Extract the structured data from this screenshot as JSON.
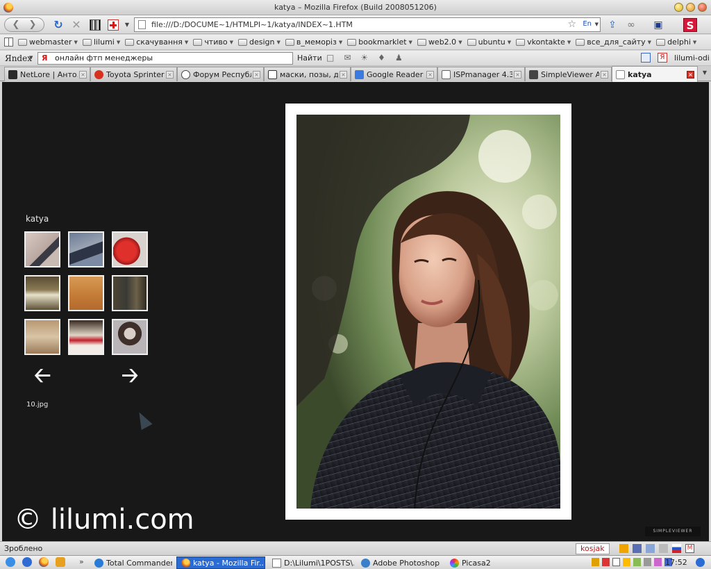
{
  "window": {
    "title": "katya – Mozilla Firefox (Build 2008051206)"
  },
  "navbar": {
    "url": "file:///D:/DOCUME~1/HTMLPI~1/katya/INDEX~1.HTM",
    "lang_indicator": "En"
  },
  "bookmarks": [
    {
      "label": "webmaster"
    },
    {
      "label": "lilumi"
    },
    {
      "label": "скачування"
    },
    {
      "label": "чтиво"
    },
    {
      "label": "design"
    },
    {
      "label": "в_меморіз"
    },
    {
      "label": "bookmarklet"
    },
    {
      "label": "web2.0"
    },
    {
      "label": "ubuntu"
    },
    {
      "label": "vkontakte"
    },
    {
      "label": "все_для_сайту"
    },
    {
      "label": "delphi"
    }
  ],
  "yandex": {
    "logo": "Яndex",
    "search_value": "онлайн фтп менеджеры",
    "find_label": "Найти",
    "user_label": "lilumi-odi"
  },
  "tabs": [
    {
      "label": "NetLore | Анто...",
      "icon": "netlore-icon",
      "active": false
    },
    {
      "label": "Toyota Sprinter ...",
      "icon": "toyota-icon",
      "active": false
    },
    {
      "label": "Форум Республ...",
      "icon": "forum-icon",
      "active": false
    },
    {
      "label": "маски, позы, д...",
      "icon": "livejournal-icon",
      "active": false
    },
    {
      "label": "Google Reader ...",
      "icon": "google-reader-icon",
      "active": false
    },
    {
      "label": "ISPmanager 4.3...",
      "icon": "ispmanager-icon",
      "active": false
    },
    {
      "label": "SimpleViewer A...",
      "icon": "simpleviewer-icon",
      "active": false
    },
    {
      "label": "katya",
      "icon": "page-icon",
      "active": true
    }
  ],
  "gallery": {
    "title": "katya",
    "filename": "10.jpg",
    "watermark": "© lilumi.com",
    "viewer_brand": "SIMPLEVIEWER",
    "thumbnails": [
      {
        "color": "#c7b8b2"
      },
      {
        "color": "#7b8aa2"
      },
      {
        "color": "#c62b2a"
      },
      {
        "color": "#6e6040"
      },
      {
        "color": "#c98a44"
      },
      {
        "color": "#4e4a3c"
      },
      {
        "color": "#a98b68"
      },
      {
        "color": "#d7cfc2"
      },
      {
        "color": "#a9a5a8"
      }
    ]
  },
  "status": {
    "text": "Зроблено",
    "addon": "kosjak"
  },
  "taskbar": {
    "tasks": [
      {
        "label": "Total Commander ...",
        "active": false
      },
      {
        "label": "katya - Mozilla Fir...",
        "active": true
      },
      {
        "label": "D:\\Lilumi\\1POSTS\\...",
        "active": false
      },
      {
        "label": "Adobe Photoshop",
        "active": false
      },
      {
        "label": "Picasa2",
        "active": false
      }
    ],
    "clock": "17:52"
  },
  "colors": {
    "page_bg": "#181818",
    "frame": "#ffffff",
    "active_task": "#2b6bd4"
  }
}
